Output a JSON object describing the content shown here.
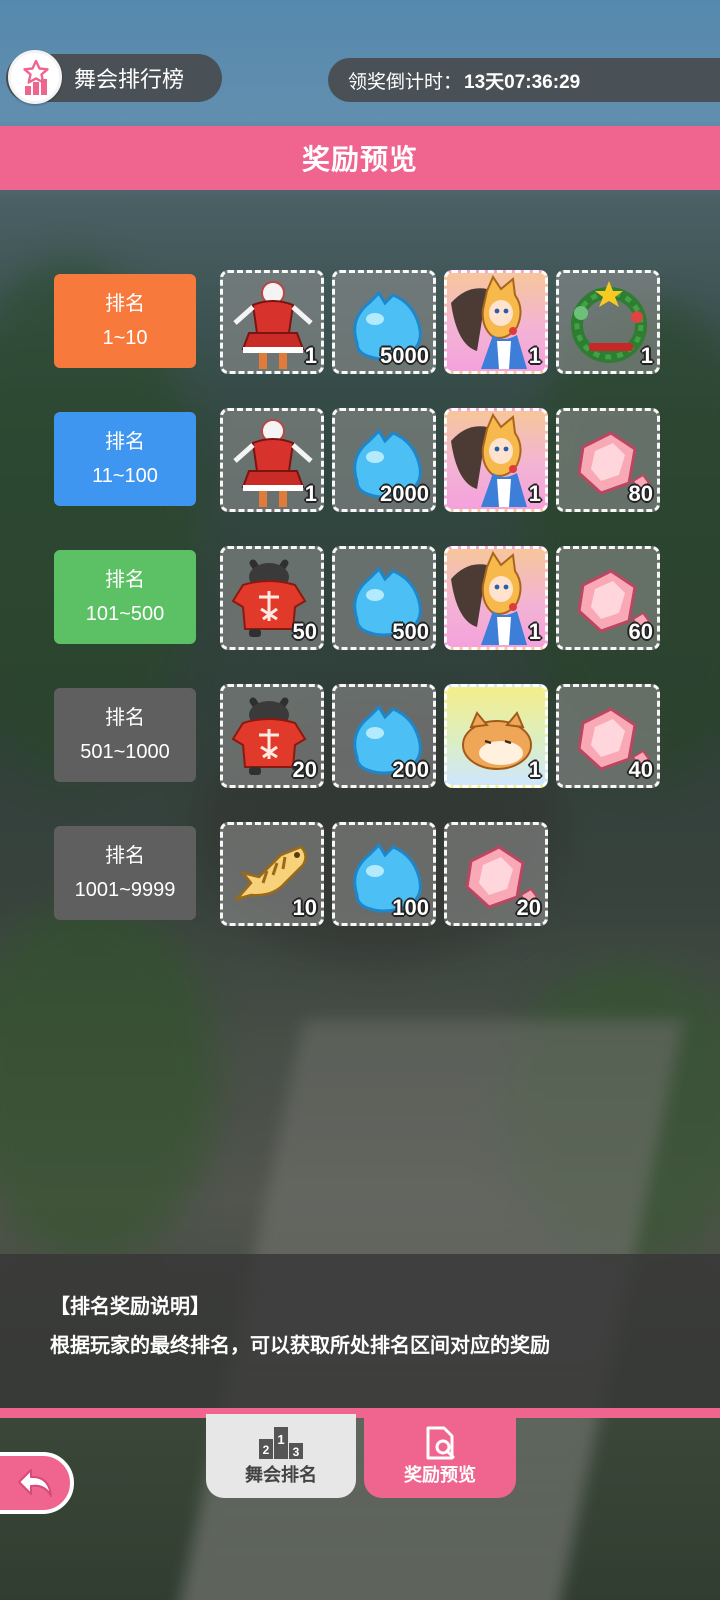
{
  "header": {
    "title": "舞会排行榜",
    "countdown_label": "领奖倒计时：",
    "countdown_value": "13天07:36:29"
  },
  "banner": {
    "title": "奖励预览"
  },
  "rows": [
    {
      "rank_label": "排名",
      "rank_range": "1~10",
      "color": "#f77a3c",
      "items": [
        {
          "icon": "santa-outfit-icon",
          "qty": "1"
        },
        {
          "icon": "blue-slime-icon",
          "qty": "5000"
        },
        {
          "icon": "cat-girl-avatar-icon",
          "qty": "1"
        },
        {
          "icon": "christmas-wreath-icon",
          "qty": "1"
        }
      ]
    },
    {
      "rank_label": "排名",
      "rank_range": "11~100",
      "color": "#3f96f0",
      "items": [
        {
          "icon": "santa-outfit-icon",
          "qty": "1"
        },
        {
          "icon": "blue-slime-icon",
          "qty": "2000"
        },
        {
          "icon": "cat-girl-avatar-icon",
          "qty": "1"
        },
        {
          "icon": "pink-gem-icon",
          "qty": "80"
        }
      ]
    },
    {
      "rank_label": "排名",
      "rank_range": "101~500",
      "color": "#5cc065",
      "items": [
        {
          "icon": "like-cat-sweater-icon",
          "qty": "50"
        },
        {
          "icon": "blue-slime-icon",
          "qty": "500"
        },
        {
          "icon": "cat-girl-avatar-icon",
          "qty": "1"
        },
        {
          "icon": "pink-gem-icon",
          "qty": "60"
        }
      ]
    },
    {
      "rank_label": "排名",
      "rank_range": "501~1000",
      "color": "#5f5f5f",
      "items": [
        {
          "icon": "like-cat-sweater-icon",
          "qty": "20"
        },
        {
          "icon": "blue-slime-icon",
          "qty": "200"
        },
        {
          "icon": "hamster-avatar-icon",
          "qty": "1"
        },
        {
          "icon": "pink-gem-icon",
          "qty": "40"
        }
      ]
    },
    {
      "rank_label": "排名",
      "rank_range": "1001~9999",
      "color": "#5f5f5f",
      "items": [
        {
          "icon": "fish-bone-icon",
          "qty": "10"
        },
        {
          "icon": "blue-slime-icon",
          "qty": "100"
        },
        {
          "icon": "pink-gem-icon",
          "qty": "20"
        }
      ]
    }
  ],
  "description": {
    "title": "【排名奖励说明】",
    "text": "根据玩家的最终排名，可以获取所处排名区间对应的奖励"
  },
  "tabs": [
    {
      "label": "舞会排名",
      "icon": "podium-icon",
      "podium_digits": [
        "2",
        "1",
        "3"
      ]
    },
    {
      "label": "奖励预览",
      "icon": "doc-search-icon"
    }
  ],
  "colors": {
    "accent": "#ef6590"
  }
}
